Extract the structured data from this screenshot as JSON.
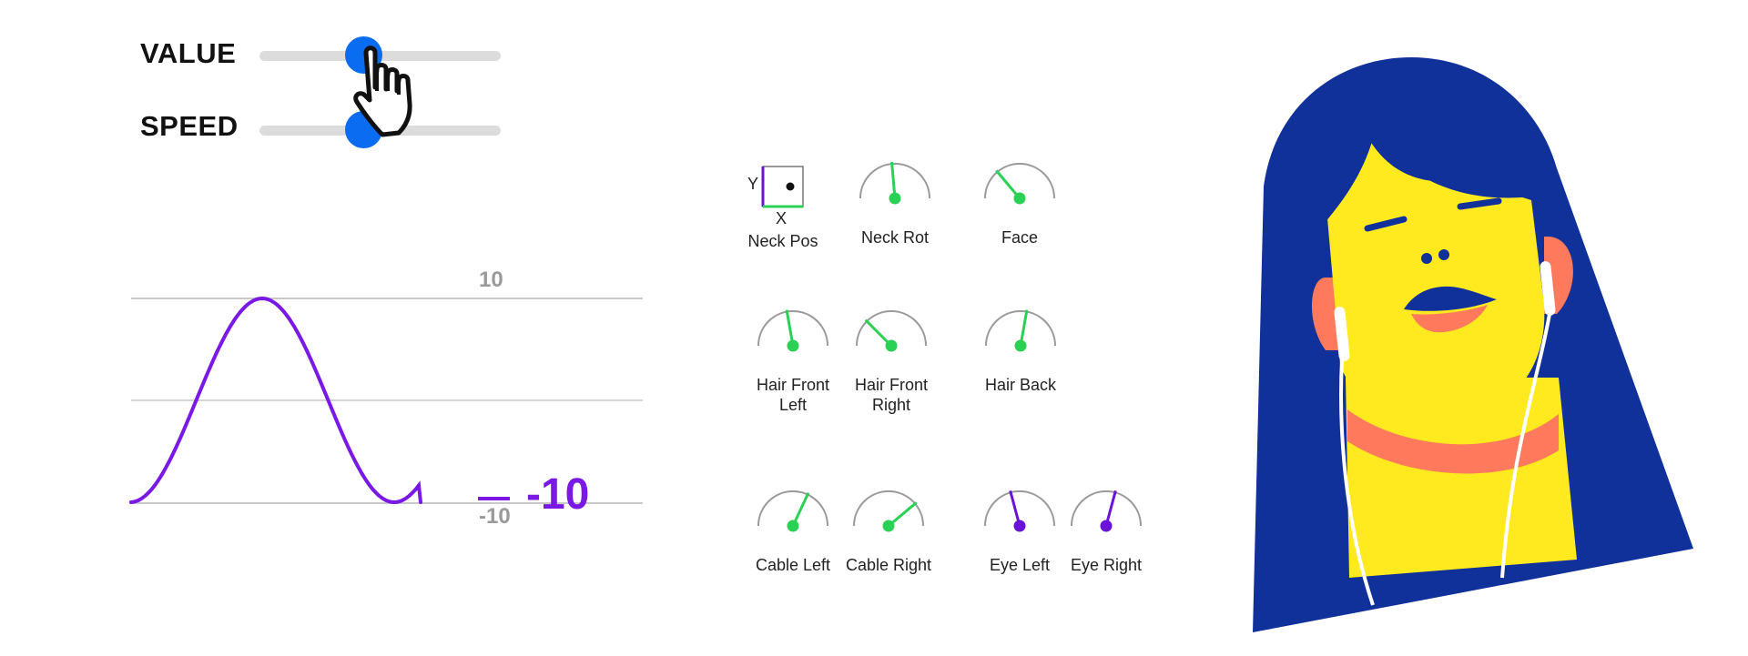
{
  "sliders": {
    "value": {
      "label": "VALUE",
      "level": 0.43
    },
    "speed": {
      "label": "SPEED",
      "level": 0.43
    }
  },
  "graph": {
    "top_value": "10",
    "bottom_value": "-10",
    "current_value": "-10",
    "line_color": "#7a18e6"
  },
  "controls": {
    "neck_pos": {
      "label": "Neck Pos",
      "y_axis": "Y",
      "x_axis": "X"
    },
    "neck_rot": {
      "label": "Neck Rot"
    },
    "face": {
      "label": "Face"
    },
    "hair_front_left": {
      "label_line1": "Hair Front",
      "label_line2": "Left"
    },
    "hair_front_right": {
      "label_line1": "Hair Front",
      "label_line2": "Right"
    },
    "hair_back": {
      "label": "Hair Back"
    },
    "cable_left": {
      "label": "Cable Left"
    },
    "cable_right": {
      "label": "Cable Right"
    },
    "eye_left": {
      "label": "Eye Left"
    },
    "eye_right": {
      "label": "Eye Right"
    }
  },
  "colors": {
    "accent_blue": "#0a6cf0",
    "dial_green": "#2bd155",
    "dial_purple": "#6a12d8",
    "hair_blue": "#10309a",
    "skin_yellow": "#ffea1f",
    "coral": "#ff7a5c"
  },
  "icons": {
    "cursor": "pointing-hand-icon"
  }
}
